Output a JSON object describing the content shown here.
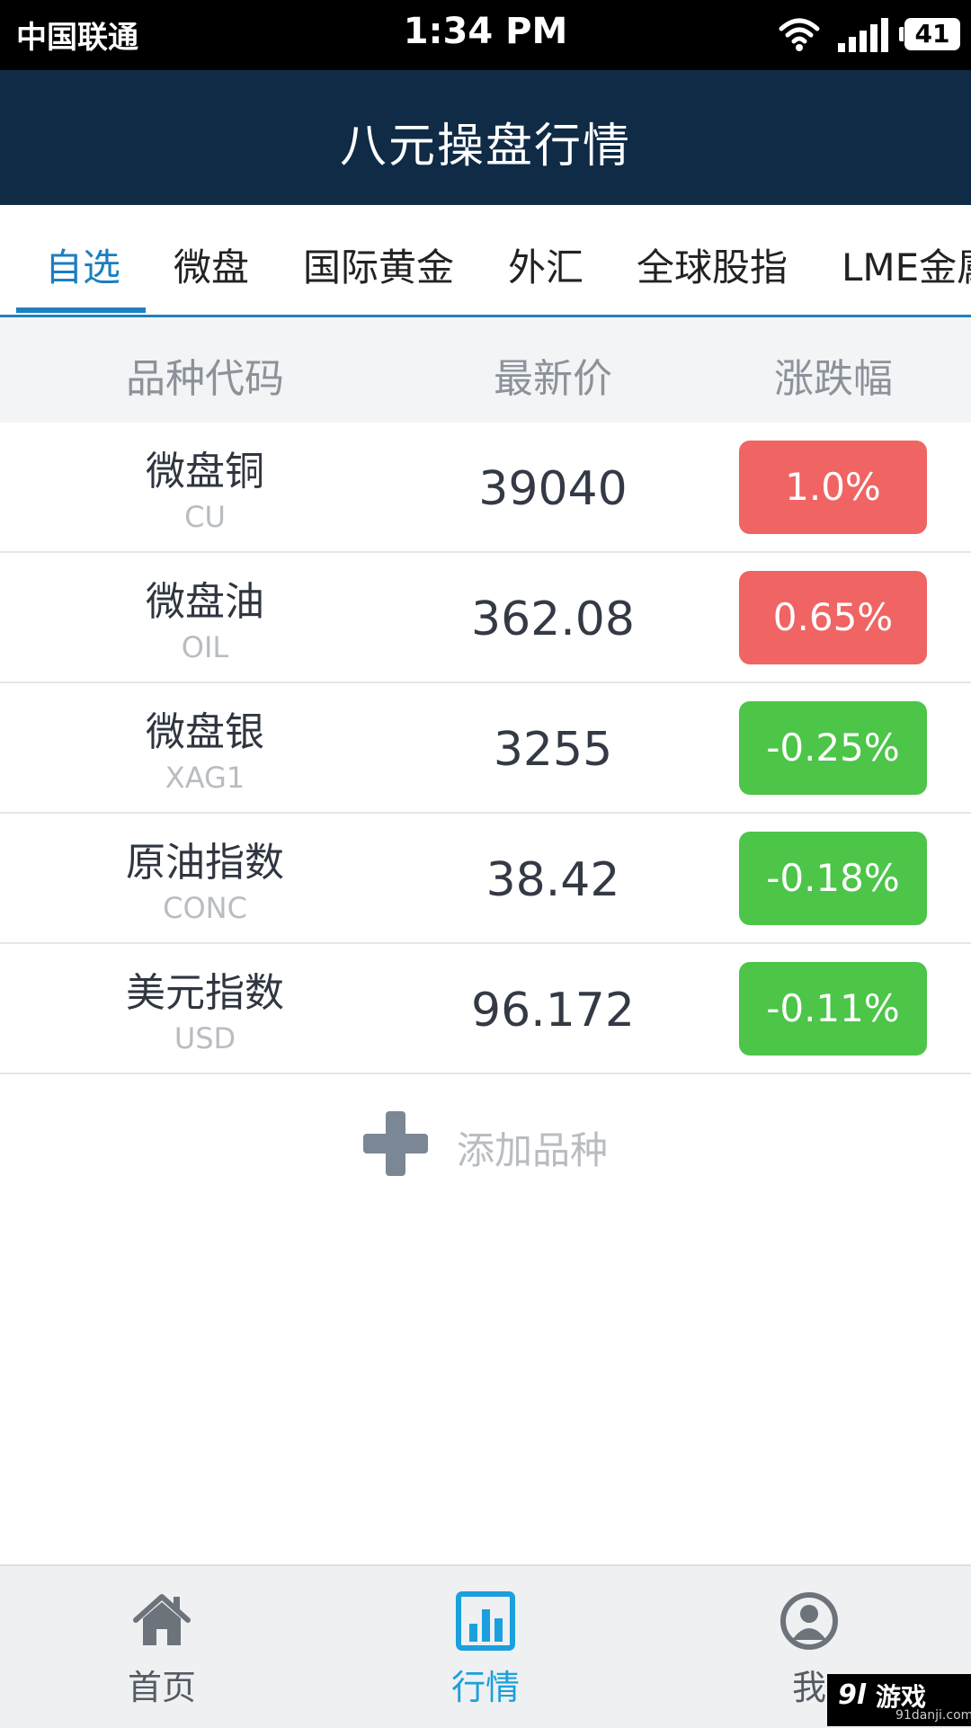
{
  "status_bar": {
    "carrier": "中国联通",
    "time": "1:34 PM",
    "battery": "41"
  },
  "header": {
    "title": "八元操盘行情"
  },
  "tabs": [
    {
      "label": "自选",
      "active": true
    },
    {
      "label": "微盘",
      "active": false
    },
    {
      "label": "国际黄金",
      "active": false
    },
    {
      "label": "外汇",
      "active": false
    },
    {
      "label": "全球股指",
      "active": false
    },
    {
      "label": "LME金属",
      "active": false
    }
  ],
  "table": {
    "columns": [
      "品种代码",
      "最新价",
      "涨跌幅"
    ],
    "rows": [
      {
        "name": "微盘铜",
        "code": "CU",
        "price": "39040",
        "change": "1.0%",
        "direction": "up"
      },
      {
        "name": "微盘油",
        "code": "OIL",
        "price": "362.08",
        "change": "0.65%",
        "direction": "up"
      },
      {
        "name": "微盘银",
        "code": "XAG1",
        "price": "3255",
        "change": "-0.25%",
        "direction": "down"
      },
      {
        "name": "原油指数",
        "code": "CONC",
        "price": "38.42",
        "change": "-0.18%",
        "direction": "down"
      },
      {
        "name": "美元指数",
        "code": "USD",
        "price": "96.172",
        "change": "-0.11%",
        "direction": "down"
      }
    ]
  },
  "add": {
    "label": "添加品种"
  },
  "bottom_nav": [
    {
      "label": "首页",
      "icon": "home-icon",
      "active": false
    },
    {
      "label": "行情",
      "icon": "chart-icon",
      "active": true
    },
    {
      "label": "我",
      "icon": "user-icon",
      "active": false
    }
  ],
  "watermark": {
    "text": "游戏",
    "sub": "91danji.com",
    "logo": "9l"
  },
  "colors": {
    "header_bg": "#0f2b46",
    "accent": "#1f80c0",
    "up": "#f06464",
    "down": "#4cc548",
    "nav_active": "#1aa0dc"
  }
}
